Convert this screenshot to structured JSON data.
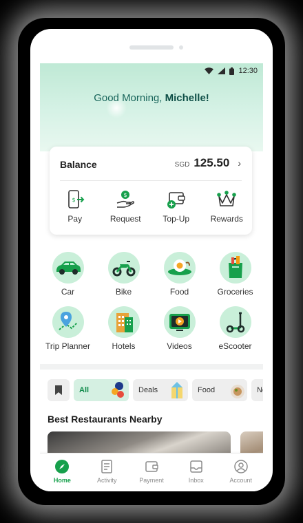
{
  "status": {
    "time": "12:30"
  },
  "header": {
    "greeting_prefix": "Good Morning, ",
    "user_name": "Michelle!"
  },
  "balance": {
    "label": "Balance",
    "currency": "SGD",
    "amount": "125.50"
  },
  "wallet_actions": [
    {
      "label": "Pay",
      "icon": "phone-pay-icon"
    },
    {
      "label": "Request",
      "icon": "hand-coin-icon"
    },
    {
      "label": "Top-Up",
      "icon": "wallet-plus-icon"
    },
    {
      "label": "Rewards",
      "icon": "crown-icon"
    }
  ],
  "services": [
    {
      "label": "Car",
      "icon": "car-icon"
    },
    {
      "label": "Bike",
      "icon": "motorbike-icon"
    },
    {
      "label": "Food",
      "icon": "food-plate-icon"
    },
    {
      "label": "Groceries",
      "icon": "grocery-bag-icon"
    },
    {
      "label": "Trip Planner",
      "icon": "map-pin-icon"
    },
    {
      "label": "Hotels",
      "icon": "hotel-icon"
    },
    {
      "label": "Videos",
      "icon": "video-play-icon"
    },
    {
      "label": "eScooter",
      "icon": "scooter-icon"
    }
  ],
  "filters": {
    "bookmark_icon": "bookmark-icon",
    "chips": [
      {
        "label": "All",
        "active": true
      },
      {
        "label": "Deals",
        "active": false
      },
      {
        "label": "Food",
        "active": false
      },
      {
        "label": "Ne",
        "active": false
      }
    ]
  },
  "section": {
    "title": "Best Restaurants Nearby"
  },
  "tabbar": [
    {
      "label": "Home",
      "icon": "compass-icon",
      "active": true
    },
    {
      "label": "Activity",
      "icon": "receipt-icon",
      "active": false
    },
    {
      "label": "Payment",
      "icon": "wallet-icon",
      "active": false
    },
    {
      "label": "Inbox",
      "icon": "inbox-icon",
      "active": false
    },
    {
      "label": "Account",
      "icon": "user-icon",
      "active": false
    }
  ],
  "colors": {
    "brand": "#17a04c",
    "mint": "#c9efd9",
    "greeting": "#17645a"
  }
}
